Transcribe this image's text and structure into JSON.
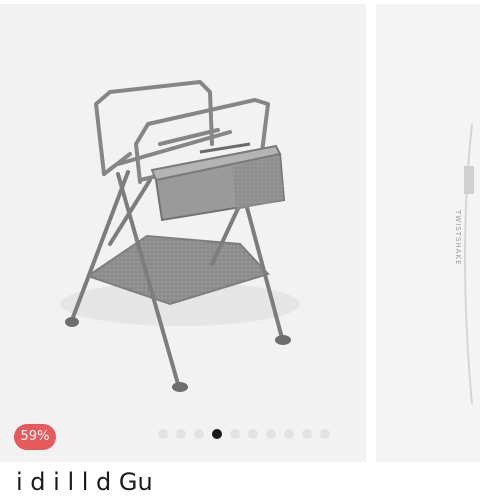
{
  "gallery": {
    "discount_badge": "59%",
    "dot_count": 10,
    "active_dot": 3,
    "next_slide_brand": "TWISTSHAKE"
  },
  "product": {
    "title_partial": "i d i l l d Gu"
  }
}
